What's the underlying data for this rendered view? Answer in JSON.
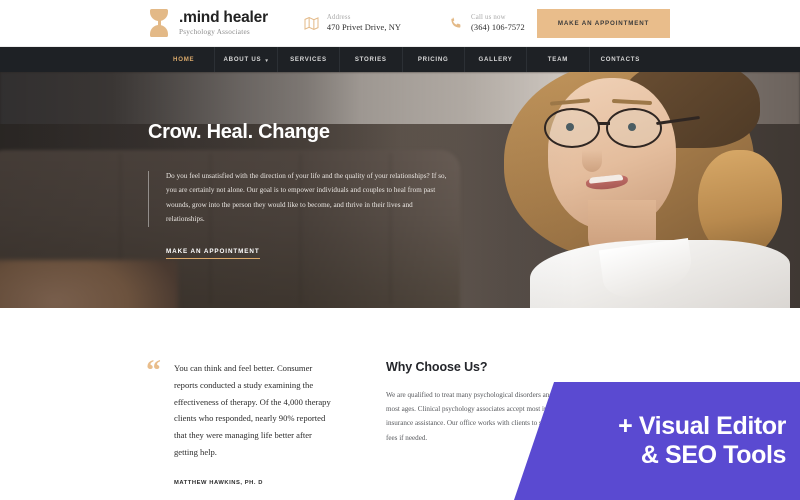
{
  "header": {
    "logo": {
      "icon": "hourglass-icon",
      "brand": ".mind healer",
      "tagline": "Psychology Associates"
    },
    "address": {
      "icon": "map-icon",
      "label": "Address",
      "value": "470 Privet Drive, NY"
    },
    "phone": {
      "icon": "phone-icon",
      "label": "Call us now",
      "value": "(364) 106-7572"
    },
    "cta_label": "MAKE AN APPOINTMENT",
    "cta_color": "#e9bd8b"
  },
  "nav": {
    "active_color": "#d9a86a",
    "background": "#1e2125",
    "items": [
      {
        "label": "HOME",
        "active": true,
        "has_dropdown": false
      },
      {
        "label": "ABOUT US",
        "active": false,
        "has_dropdown": true
      },
      {
        "label": "SERVICES",
        "active": false,
        "has_dropdown": false
      },
      {
        "label": "STORIES",
        "active": false,
        "has_dropdown": false
      },
      {
        "label": "PRICING",
        "active": false,
        "has_dropdown": false
      },
      {
        "label": "GALLERY",
        "active": false,
        "has_dropdown": false
      },
      {
        "label": "TEAM",
        "active": false,
        "has_dropdown": false
      },
      {
        "label": "CONTACTS",
        "active": false,
        "has_dropdown": false
      }
    ]
  },
  "hero": {
    "title": "Crow. Heal. Change",
    "paragraph": "Do you feel unsatisfied with the direction of your life and the quality of your relationships? If so, you are certainly not alone. Our goal is to empower individuals and couples to heal from past wounds, grow into the person they would like to become, and thrive in their lives and relationships.",
    "link_label": "MAKE AN APPOINTMENT"
  },
  "testimonial": {
    "quote_icon": "quote-mark-icon",
    "text": "You can think and feel better. Consumer reports conducted a study examining the effectiveness of therapy. Of the 4,000 therapy clients who responded, nearly 90% reported that they were managing life better after getting help.",
    "author": "MATTHEW HAWKINS, PH. D"
  },
  "why_choose_us": {
    "title": "Why Choose Us?",
    "text": "We are qualified to treat many psychological disorders and behavioral issues in most ages. Clinical psychology associates accept most insurance plans and provide insurance assistance. Our office works with clients to set reasonable out-of-pocket fees if needed."
  },
  "promo": {
    "line1": "+ Visual Editor",
    "line2": "& SEO Tools",
    "color": "#5a4ad1"
  }
}
